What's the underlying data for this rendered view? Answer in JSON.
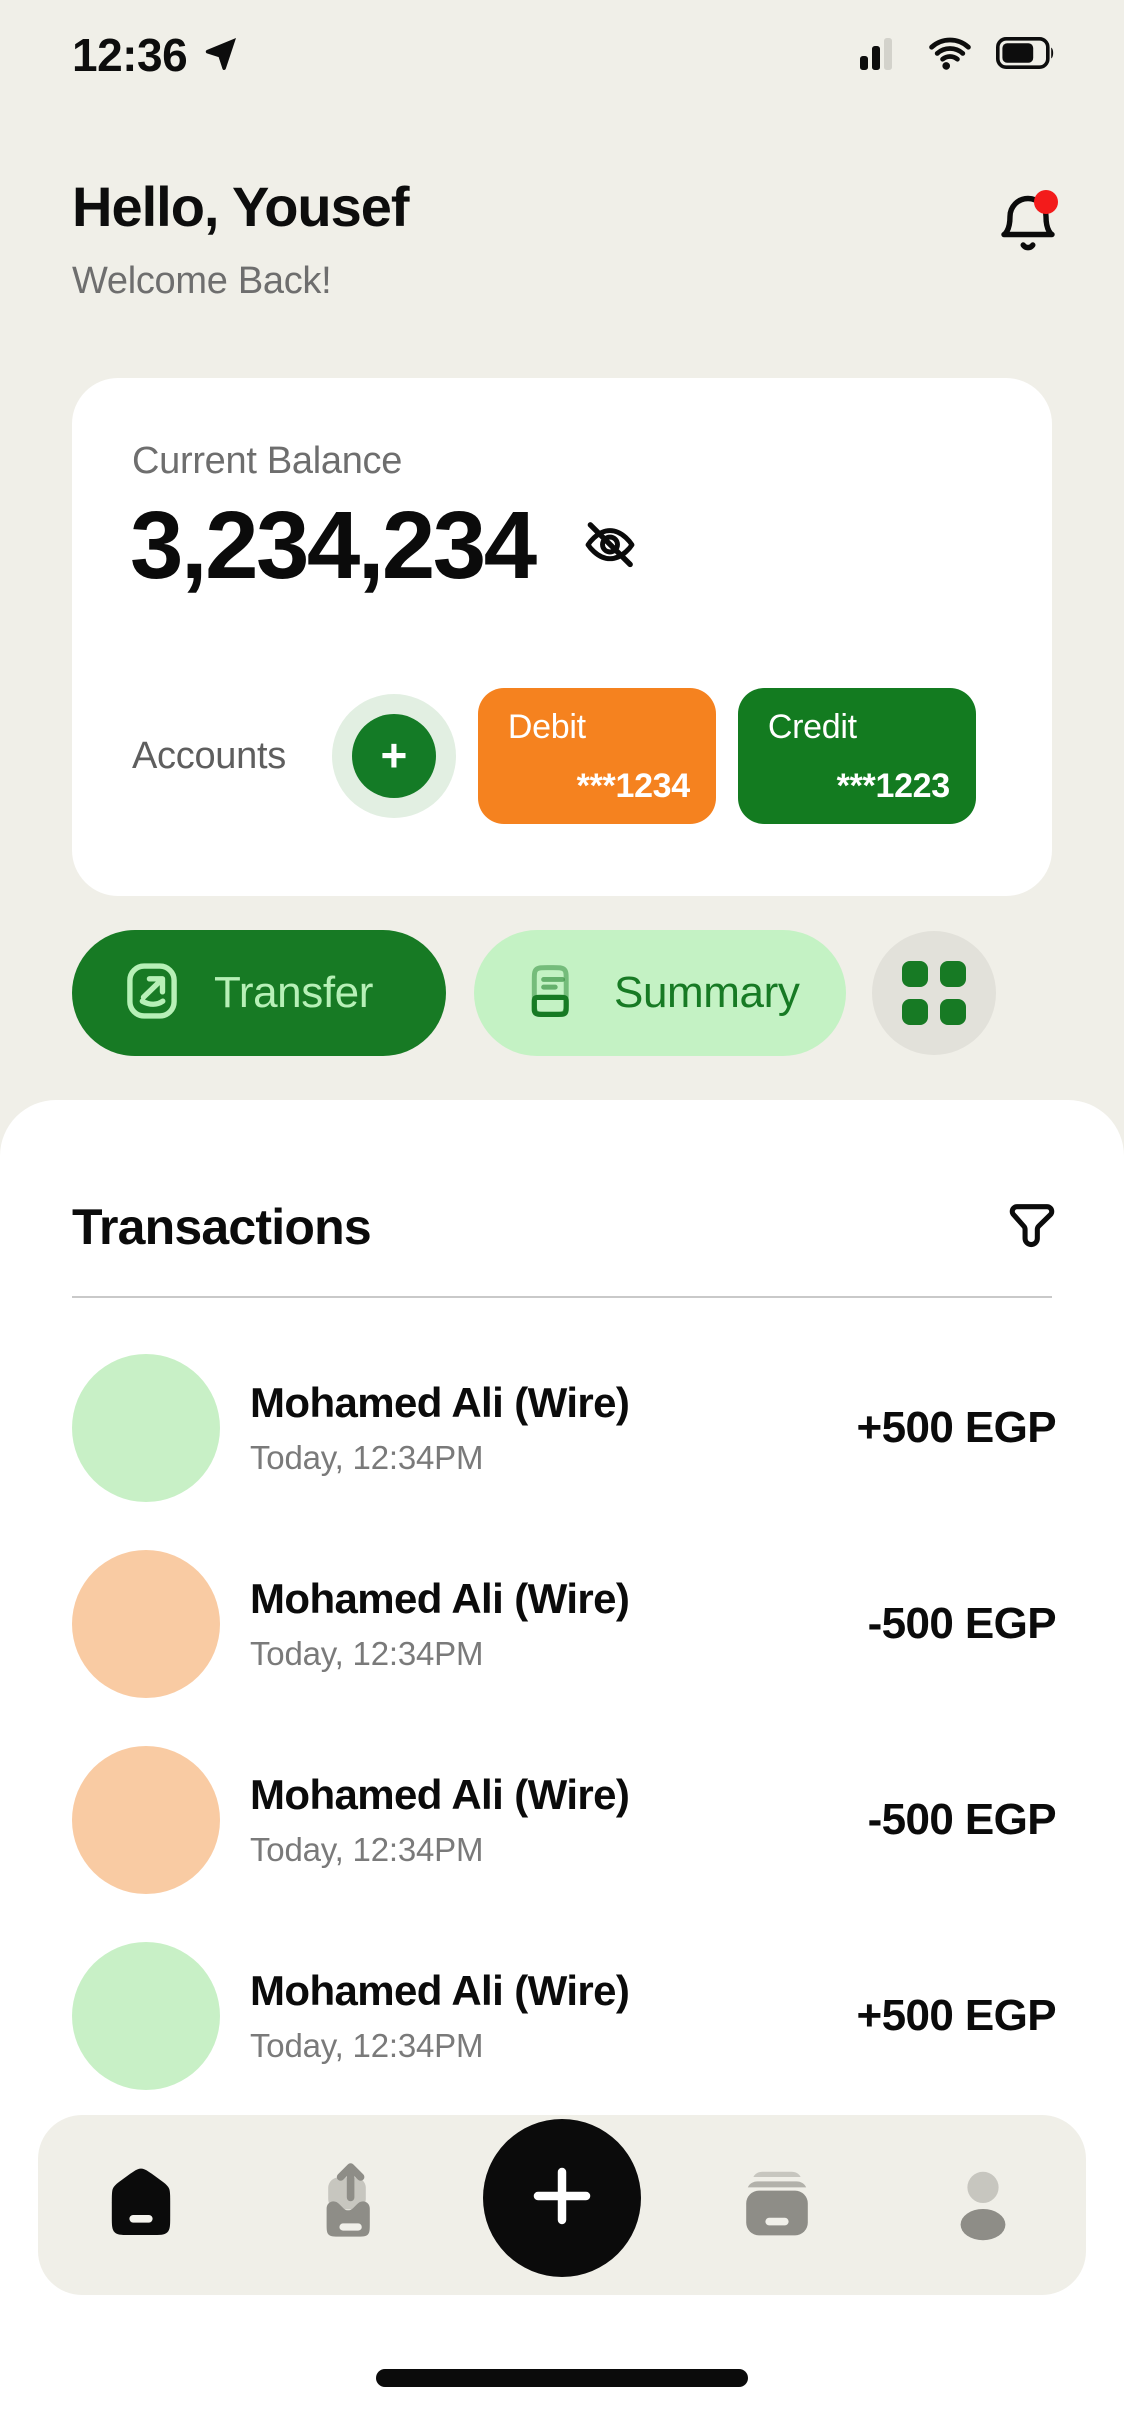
{
  "status_bar": {
    "time": "12:36",
    "location_icon": "location-arrow-icon",
    "signal_icon": "cellular-signal-icon",
    "wifi_icon": "wifi-icon",
    "battery_icon": "battery-icon"
  },
  "header": {
    "greeting": "Hello, Yousef",
    "subtitle": "Welcome Back!",
    "notification_icon": "bell-icon",
    "has_notification": true,
    "notification_dot_color": "#f31b1b"
  },
  "balance_card": {
    "label": "Current Balance",
    "amount": "3,234,234",
    "visibility_icon": "eye-off-icon",
    "accounts_label": "Accounts",
    "add_account_icon": "plus-icon",
    "accounts": [
      {
        "type": "Debit",
        "number": "***1234",
        "color": "#f5821f"
      },
      {
        "type": "Credit",
        "number": "***1223",
        "color": "#137b20"
      }
    ]
  },
  "actions": {
    "transfer": {
      "label": "Transfer",
      "icon": "transfer-arrow-icon",
      "bg": "#177a24",
      "fg": "#b7f0b7"
    },
    "summary": {
      "label": "Summary",
      "icon": "document-icon",
      "bg": "#c4f2c4",
      "fg": "#177a24"
    },
    "more": {
      "icon": "grid-apps-icon",
      "bg": "#e2e1da"
    }
  },
  "transactions": {
    "title": "Transactions",
    "filter_icon": "filter-funnel-icon",
    "items": [
      {
        "name": "Mohamed Ali (Wire)",
        "time": "Today, 12:34PM",
        "amount": "+500 EGP",
        "direction": "in",
        "avatar_color": "#c8f0c6"
      },
      {
        "name": "Mohamed Ali (Wire)",
        "time": "Today, 12:34PM",
        "amount": "-500 EGP",
        "direction": "out",
        "avatar_color": "#f9cba3"
      },
      {
        "name": "Mohamed Ali (Wire)",
        "time": "Today, 12:34PM",
        "amount": "-500 EGP",
        "direction": "out",
        "avatar_color": "#f9cba3"
      },
      {
        "name": "Mohamed Ali (Wire)",
        "time": "Today, 12:34PM",
        "amount": "+500 EGP",
        "direction": "in",
        "avatar_color": "#c8f0c6"
      }
    ]
  },
  "bottom_nav": {
    "items": [
      {
        "icon": "home-icon",
        "active": true
      },
      {
        "icon": "send-up-icon",
        "active": false
      },
      {
        "icon": "plus-icon",
        "active": false,
        "is_fab": true
      },
      {
        "icon": "cards-stack-icon",
        "active": false
      },
      {
        "icon": "profile-person-icon",
        "active": false
      }
    ]
  }
}
